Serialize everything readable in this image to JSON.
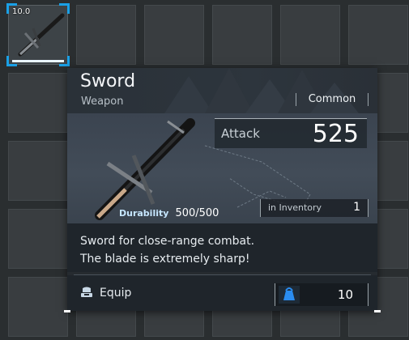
{
  "inventory": {
    "selected_slot": {
      "weight": "10.0",
      "item": "Sword"
    }
  },
  "tooltip": {
    "title": "Sword",
    "type": "Weapon",
    "rarity": "Common",
    "stats": {
      "attack_label": "Attack",
      "attack_value": "525",
      "durability_label": "Durability",
      "durability_value": "500/500",
      "inventory_label": "in Inventory",
      "inventory_count": "1"
    },
    "description": [
      "Sword for close-range combat.",
      "The blade is extremely sharp!"
    ],
    "actions": {
      "equip_label": "Equip"
    },
    "price": "10"
  },
  "colors": {
    "selection": "#1aa0e6",
    "price_icon": "#2a8cf0"
  }
}
